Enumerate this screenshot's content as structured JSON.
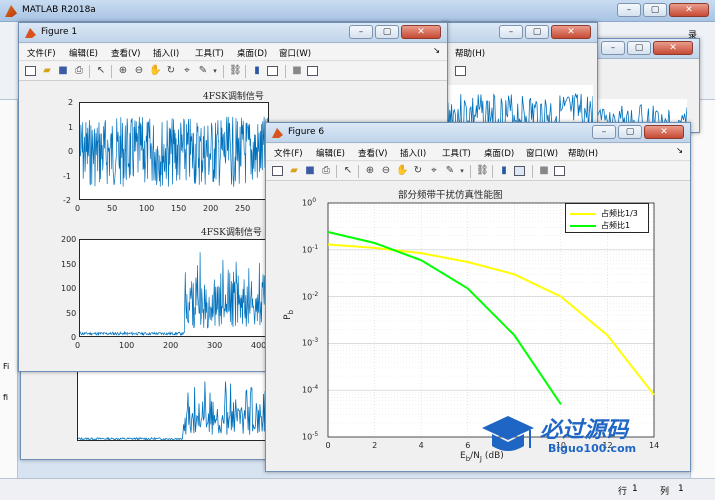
{
  "app": {
    "title": "MATLAB R2018a",
    "right_label": "录"
  },
  "menus": [
    "文件(F)",
    "编辑(E)",
    "查看(V)",
    "插入(I)",
    "工具(T)",
    "桌面(D)",
    "窗口(W)",
    "帮助(H)"
  ],
  "fig1": {
    "title": "Figure 1",
    "plot1": {
      "title": "4FSK调制信号",
      "yticks": [
        "2",
        "1",
        "0",
        "-1",
        "-2"
      ],
      "xticks": [
        "0",
        "50",
        "100",
        "150",
        "200",
        "250"
      ]
    },
    "plot2": {
      "title": "4FSK调制信号",
      "yticks": [
        "200",
        "150",
        "100",
        "50",
        "0"
      ],
      "xticks": [
        "0",
        "100",
        "200",
        "300",
        "400"
      ]
    }
  },
  "fig6": {
    "title": "Figure 6"
  },
  "left_panel": {
    "label_fi": "Fi",
    "label_fi2": "fi"
  },
  "status": {
    "row_label": "行",
    "row_value": "1",
    "col_label": "列",
    "col_value": "1"
  },
  "watermark": {
    "brand": "必过源码",
    "site": "Biguo100.com"
  },
  "colors": {
    "yellow": "#ffff00",
    "green": "#00ff00",
    "signal": "#0072bd"
  },
  "chart_data": [
    {
      "type": "line",
      "title": "部分频带干扰仿真性能图",
      "xlabel_base": "E",
      "xlabel_sub": "b",
      "xlabel_mid": "/N",
      "xlabel_sub2": "J",
      "xlabel_unit": " (dB)",
      "ylabel_base": "P",
      "ylabel_sub": "b",
      "x": [
        0,
        2,
        4,
        6,
        8,
        10,
        12,
        14
      ],
      "xlim": [
        0,
        14
      ],
      "ylim": [
        1e-05,
        1
      ],
      "yscale": "log",
      "grid": true,
      "legend": "top-right",
      "xticks": [
        "0",
        "2",
        "4",
        "6",
        "8",
        "10",
        "12",
        "14"
      ],
      "yticks": [
        {
          "b": "10",
          "e": "0"
        },
        {
          "b": "10",
          "e": "-1"
        },
        {
          "b": "10",
          "e": "-2"
        },
        {
          "b": "10",
          "e": "-3"
        },
        {
          "b": "10",
          "e": "-4"
        },
        {
          "b": "10",
          "e": "-5"
        }
      ],
      "series": [
        {
          "name": "占频比1/3",
          "color": "#ffff00",
          "values": [
            0.13,
            0.11,
            0.085,
            0.055,
            0.03,
            0.01,
            0.0015,
            8e-05
          ]
        },
        {
          "name": "占频比1",
          "color": "#00ff00",
          "values": [
            0.24,
            0.14,
            0.06,
            0.015,
            0.0015,
            5e-05,
            null,
            null
          ]
        }
      ]
    }
  ]
}
